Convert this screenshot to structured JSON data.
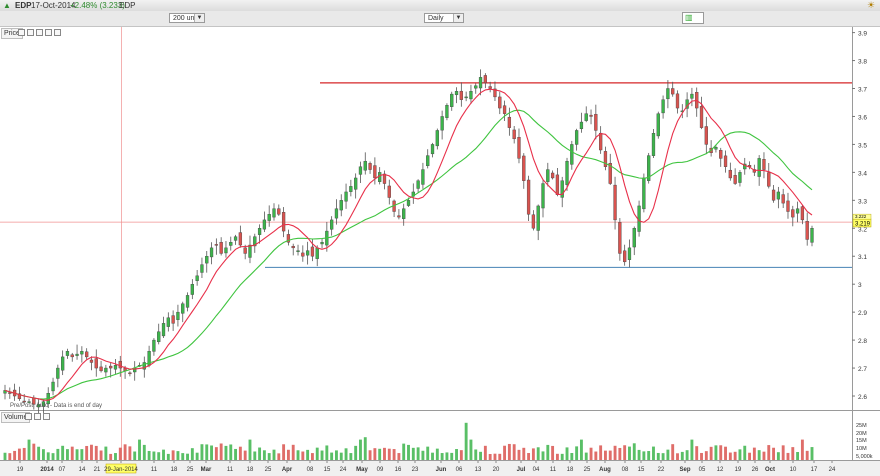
{
  "header": {
    "symbol": "EDP",
    "date": "17-Oct-2014",
    "change": "+2.48% (3.233)",
    "name": "EDP"
  },
  "toolbar": {
    "units_value": "200 units",
    "interval_value": "Daily"
  },
  "panels": {
    "price_label": "Price",
    "volume_label": "Volume",
    "annotation_text": "Pre/Post: Auto - Data is end of day"
  },
  "colors": {
    "up": "#3cb44b",
    "down": "#d9534f",
    "ma_fast": "#e8304a",
    "ma_slow": "#3fc43f",
    "resistance": "#d62728",
    "support": "#4682b4",
    "crosshair": "#f09090",
    "price_marker": "#ffff66"
  },
  "chart_data": {
    "type": "candlestick",
    "price_axis": {
      "min": 2.55,
      "max": 3.92,
      "ticks": [
        "3.9",
        "3.8",
        "3.7",
        "3.6",
        "3.5",
        "3.4",
        "3.3",
        "3.2",
        "3.1",
        "3",
        "2.9",
        "2.8",
        "2.7",
        "2.6"
      ]
    },
    "volume_axis": {
      "ticks": [
        "25M",
        "20M",
        "15M",
        "10M",
        "5,000k"
      ]
    },
    "x_axis": {
      "labels": [
        "19",
        "2014",
        "07",
        "14",
        "21",
        "29-Jan-2014",
        "11",
        "18",
        "25",
        "Mar",
        "11",
        "18",
        "25",
        "Apr",
        "08",
        "15",
        "24",
        "May",
        "09",
        "16",
        "23",
        "Jun",
        "06",
        "13",
        "20",
        "Jul",
        "04",
        "11",
        "18",
        "25",
        "Aug",
        "08",
        "15",
        "22",
        "Sep",
        "05",
        "12",
        "19",
        "26",
        "Oct",
        "10",
        "17",
        "24"
      ],
      "highlighted": "29-Jan-2014"
    },
    "last_price": "3.219",
    "second_marker": "3.222",
    "crosshair_price": 3.222,
    "resistance_level": 3.72,
    "support_level": 3.06,
    "moving_averages": [
      "fast (red)",
      "slow (green)"
    ],
    "close": [
      2.62,
      2.61,
      2.6,
      2.59,
      2.58,
      2.58,
      2.57,
      2.57,
      2.58,
      2.61,
      2.65,
      2.7,
      2.74,
      2.76,
      2.74,
      2.75,
      2.76,
      2.74,
      2.72,
      2.7,
      2.69,
      2.7,
      2.7,
      2.71,
      2.7,
      2.69,
      2.68,
      2.7,
      2.71,
      2.72,
      2.76,
      2.8,
      2.83,
      2.86,
      2.88,
      2.86,
      2.9,
      2.93,
      2.96,
      3.0,
      3.03,
      3.07,
      3.1,
      3.13,
      3.14,
      3.11,
      3.13,
      3.15,
      3.17,
      3.14,
      3.11,
      3.14,
      3.17,
      3.2,
      3.23,
      3.25,
      3.27,
      3.25,
      3.19,
      3.15,
      3.13,
      3.12,
      3.1,
      3.12,
      3.1,
      3.13,
      3.15,
      3.19,
      3.23,
      3.27,
      3.3,
      3.33,
      3.35,
      3.38,
      3.42,
      3.44,
      3.41,
      3.38,
      3.4,
      3.36,
      3.31,
      3.26,
      3.24,
      3.27,
      3.3,
      3.33,
      3.37,
      3.41,
      3.46,
      3.5,
      3.55,
      3.6,
      3.64,
      3.68,
      3.69,
      3.66,
      3.67,
      3.69,
      3.71,
      3.74,
      3.72,
      3.7,
      3.67,
      3.63,
      3.61,
      3.56,
      3.52,
      3.45,
      3.37,
      3.25,
      3.2,
      3.28,
      3.36,
      3.41,
      3.38,
      3.32,
      3.37,
      3.44,
      3.5,
      3.55,
      3.58,
      3.61,
      3.6,
      3.55,
      3.48,
      3.42,
      3.36,
      3.23,
      3.11,
      3.08,
      3.13,
      3.2,
      3.28,
      3.38,
      3.46,
      3.54,
      3.61,
      3.66,
      3.7,
      3.68,
      3.63,
      3.62,
      3.66,
      3.68,
      3.63,
      3.56,
      3.5,
      3.47,
      3.49,
      3.45,
      3.42,
      3.38,
      3.36,
      3.4,
      3.43,
      3.42,
      3.4,
      3.45,
      3.41,
      3.35,
      3.3,
      3.33,
      3.29,
      3.26,
      3.24,
      3.27,
      3.23,
      3.16,
      3.2
    ]
  }
}
